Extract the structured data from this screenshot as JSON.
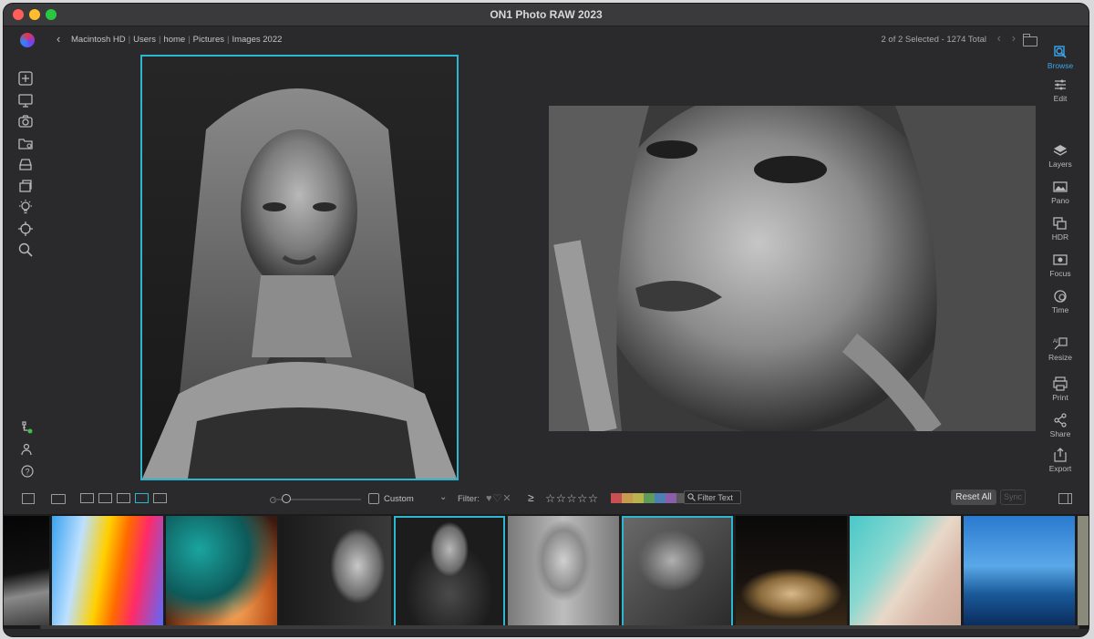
{
  "window": {
    "title": "ON1 Photo RAW 2023"
  },
  "breadcrumb": [
    "Macintosh HD",
    "Users",
    "home",
    "Pictures",
    "Images 2022"
  ],
  "selection_info": "2 of 2 Selected - 1274 Total",
  "right_panel": {
    "items": [
      {
        "label": "Browse",
        "icon": "browse-icon",
        "active": true
      },
      {
        "label": "Edit",
        "icon": "sliders-icon"
      },
      {
        "label": "Layers",
        "icon": "layers-icon"
      },
      {
        "label": "Pano",
        "icon": "panorama-icon"
      },
      {
        "label": "HDR",
        "icon": "hdr-icon"
      },
      {
        "label": "Focus",
        "icon": "focus-icon"
      },
      {
        "label": "Time",
        "icon": "time-icon"
      },
      {
        "label": "Resize",
        "icon": "resize-icon"
      },
      {
        "label": "Print",
        "icon": "print-icon"
      },
      {
        "label": "Share",
        "icon": "share-icon"
      },
      {
        "label": "Export",
        "icon": "export-icon"
      }
    ],
    "resize_badge": "AI"
  },
  "bottom_toolbar": {
    "sort_label": "Custom",
    "filter_label": "Filter:",
    "filter_text_placeholder": "Filter Text",
    "reset_button": "Reset All",
    "sync_button": "Sync",
    "stars": "☆☆☆☆☆",
    "gte_symbol": "≥",
    "color_labels": [
      "#c85050",
      "#c89a50",
      "#b9b24e",
      "#5e9a58",
      "#4d7fb4",
      "#8a5ea8",
      "#5a5a5a"
    ]
  },
  "filmstrip": {
    "thumbnails": [
      {
        "kind": "mountain-bw",
        "selected": false
      },
      {
        "kind": "colorful-abstract",
        "selected": false
      },
      {
        "kind": "teal-orange-hand",
        "selected": false
      },
      {
        "kind": "portrait-bw-woman",
        "selected": false
      },
      {
        "kind": "portrait-bw-woman-hair",
        "selected": true
      },
      {
        "kind": "portrait-bw-closeup",
        "selected": false
      },
      {
        "kind": "portrait-bw-hands",
        "selected": true
      },
      {
        "kind": "champagne-glasses",
        "selected": false
      },
      {
        "kind": "beach-aerial",
        "selected": false
      },
      {
        "kind": "pier-blue",
        "selected": false
      },
      {
        "kind": "partial",
        "selected": false
      }
    ]
  }
}
